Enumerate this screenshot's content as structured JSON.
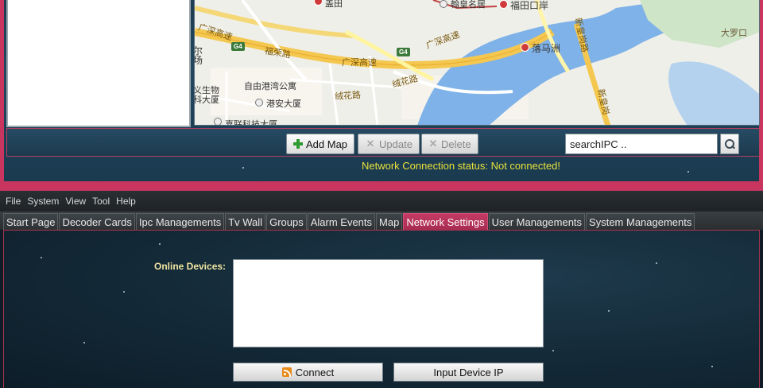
{
  "map_window": {
    "toolbar": {
      "add_map_label": "Add Map",
      "update_label": "Update",
      "delete_label": "Delete",
      "search_value": "searchIPC .."
    },
    "status_text": "Network Connection status: Not connected!",
    "map_labels": {
      "top_left_poi": "盖田",
      "hanxiang": "翰皇名居",
      "futian_port": "福田口岸",
      "luomazhou": "落马洲",
      "daluokou": "大罗口",
      "guangshen_1": "广深高速",
      "guangshen_2": "广深高速",
      "furong_road": "福荣路",
      "rongxiang_road": "绒花路",
      "rongxiang_road_2": "绒花路",
      "zimao": "自由港湾公寓",
      "gangan": "港安大厦",
      "building_left": "义生物 科大厦",
      "mall_left": "尔 场",
      "bottom_building": "嘉联科技大厦",
      "xinhuang_road": "新皇岗路",
      "right_road": "新皇岗",
      "g4": "G4"
    }
  },
  "menubar": {
    "items": [
      "File",
      "System",
      "View",
      "Tool",
      "Help"
    ]
  },
  "tabs": [
    {
      "label": "Start Page",
      "active": false
    },
    {
      "label": "Decoder Cards",
      "active": false
    },
    {
      "label": "Ipc Managements",
      "active": false
    },
    {
      "label": "Tv Wall",
      "active": false
    },
    {
      "label": "Groups",
      "active": false
    },
    {
      "label": "Alarm Events",
      "active": false
    },
    {
      "label": "Map",
      "active": false
    },
    {
      "label": "Network Settings",
      "active": true
    },
    {
      "label": "User Managements",
      "active": false
    },
    {
      "label": "System Managements",
      "active": false
    }
  ],
  "network_settings": {
    "online_devices_label": "Online Devices:",
    "connect_label": "Connect",
    "input_device_ip_label": "Input Device IP"
  },
  "colors": {
    "accent": "#c8355e",
    "status_text": "#e8e13a",
    "label_yellow": "#f0e6a0"
  },
  "icons": {
    "add_map": "plus-icon",
    "update": "tools-icon",
    "delete": "x-icon",
    "search": "search-icon",
    "connect": "rss-icon"
  }
}
